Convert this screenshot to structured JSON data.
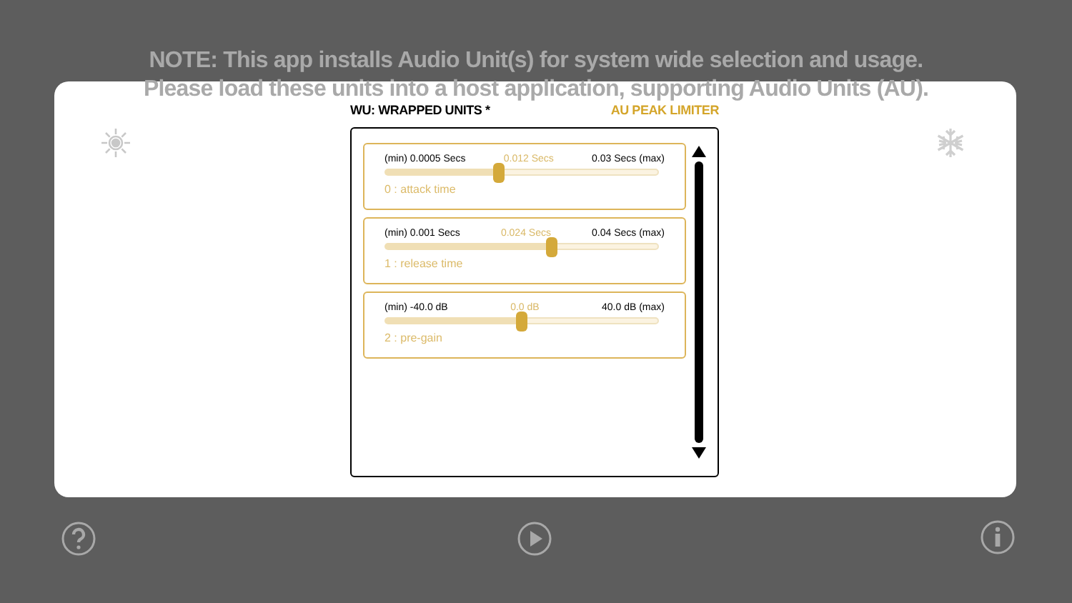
{
  "note": [
    "NOTE: This app installs Audio Unit(s) for system wide selection and usage.",
    "Please load these units into a host application, supporting Audio Units (AU)."
  ],
  "header": {
    "title": "WU: WRAPPED UNITS *",
    "plugin": "AU PEAK LIMITER"
  },
  "parameters": [
    {
      "min": "(min) 0.0005 Secs",
      "value": "0.012 Secs",
      "max": "0.03 Secs (max)",
      "level": 0.417,
      "label": "0 : attack time"
    },
    {
      "min": "(min) 0.001 Secs",
      "value": "0.024 Secs",
      "max": "0.04 Secs (max)",
      "level": 0.61,
      "label": "1 : release time"
    },
    {
      "min": "(min) -40.0 dB",
      "value": "0.0 dB",
      "max": "40.0 dB (max)",
      "level": 0.5,
      "label": "2 : pre-gain"
    }
  ]
}
